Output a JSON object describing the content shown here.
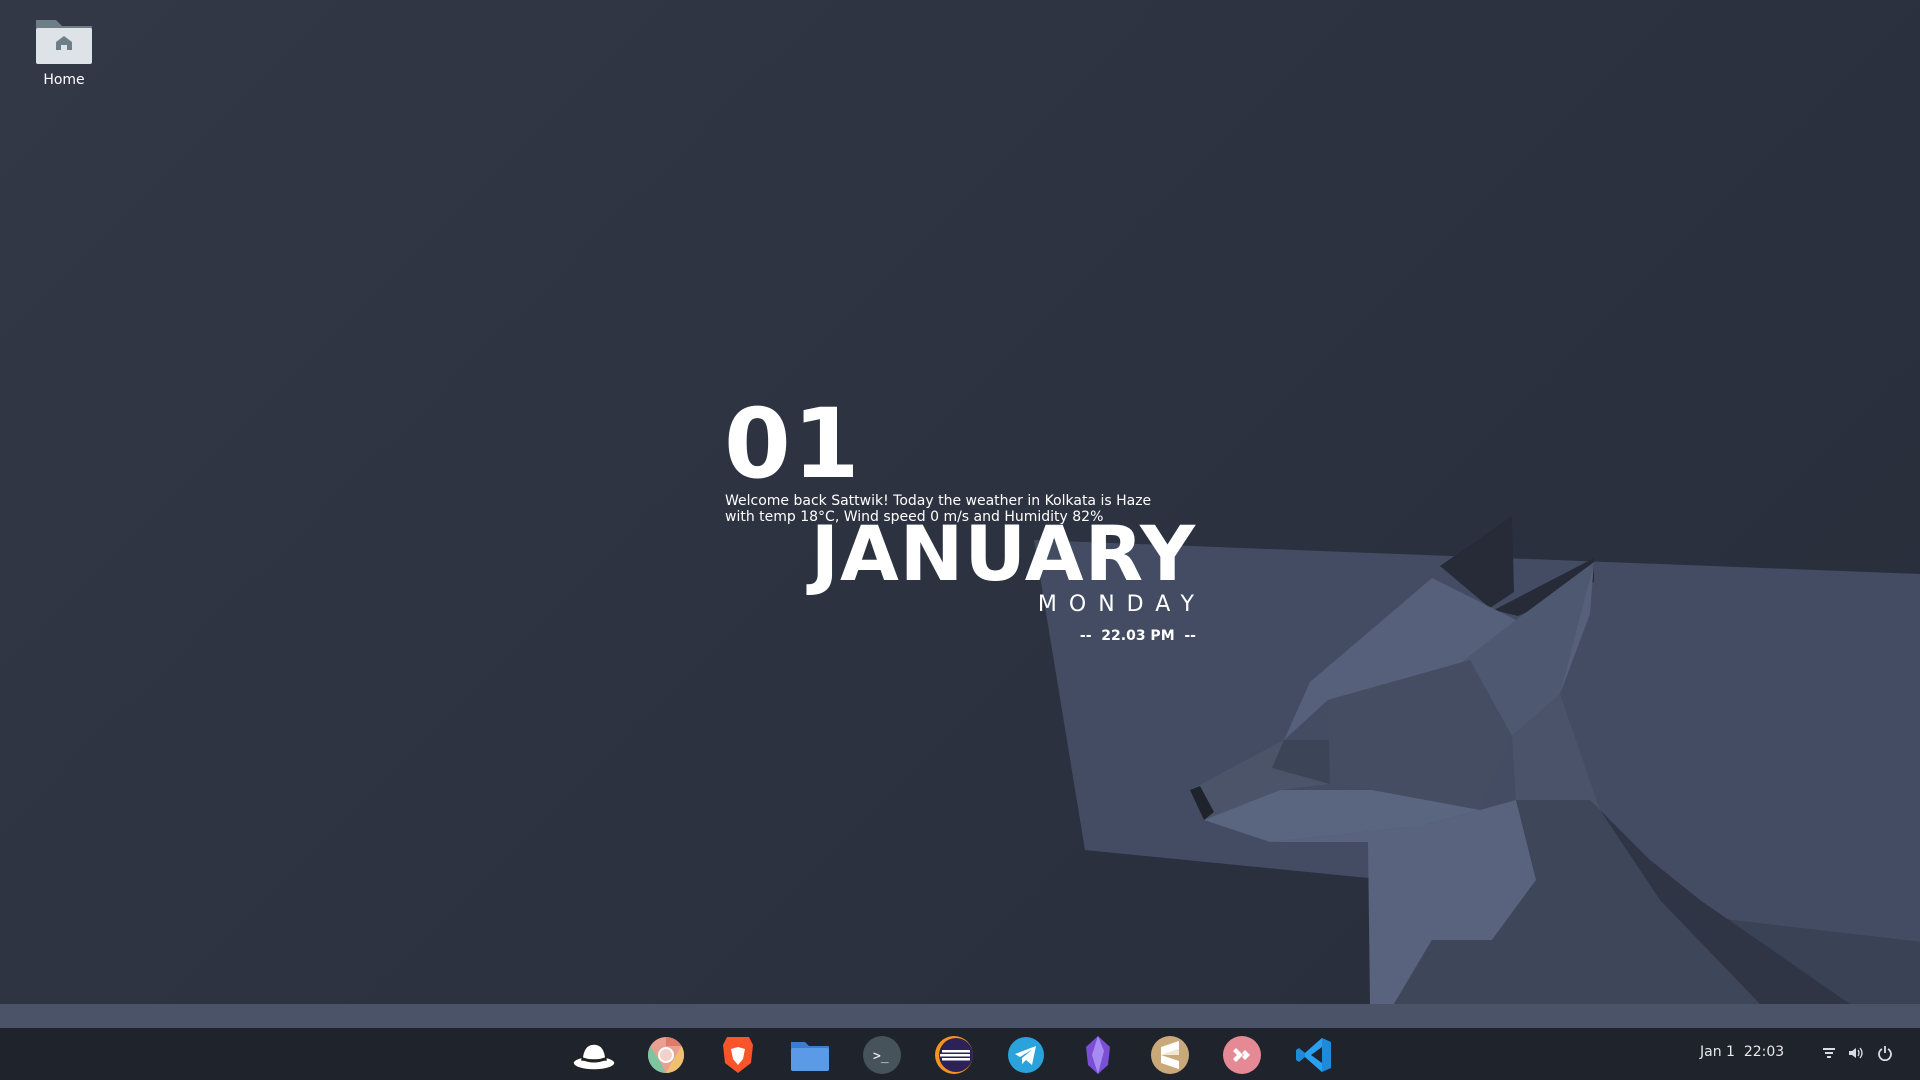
{
  "desktop": {
    "icons": [
      {
        "label": "Home",
        "icon": "home-folder-icon"
      }
    ]
  },
  "widget": {
    "day_number": "01",
    "welcome_line1": "Welcome back Sattwik! Today the weather in Kolkata is Haze",
    "welcome_line2": "with temp 18°C, Wind speed 0 m/s and Humidity 82%",
    "month": "JANUARY",
    "weekday": "MONDAY",
    "time": "--  22.03 PM  --"
  },
  "dock": {
    "apps": [
      {
        "name": "redhat-hat-icon"
      },
      {
        "name": "chromium-icon"
      },
      {
        "name": "brave-icon"
      },
      {
        "name": "files-icon"
      },
      {
        "name": "terminal-icon"
      },
      {
        "name": "eclipse-icon"
      },
      {
        "name": "telegram-icon"
      },
      {
        "name": "obsidian-icon"
      },
      {
        "name": "sublime-text-icon"
      },
      {
        "name": "anydesk-icon"
      },
      {
        "name": "vscode-icon"
      }
    ]
  },
  "tray": {
    "clock": "Jan 1  22:03",
    "icons": [
      "network-icon",
      "volume-icon",
      "power-icon"
    ]
  },
  "colors": {
    "background": "#2e3441",
    "wolf_light": "#5a6580",
    "wolf_mid": "#454d63",
    "panel": "#1f232c",
    "panel_strip": "#4a5367"
  }
}
